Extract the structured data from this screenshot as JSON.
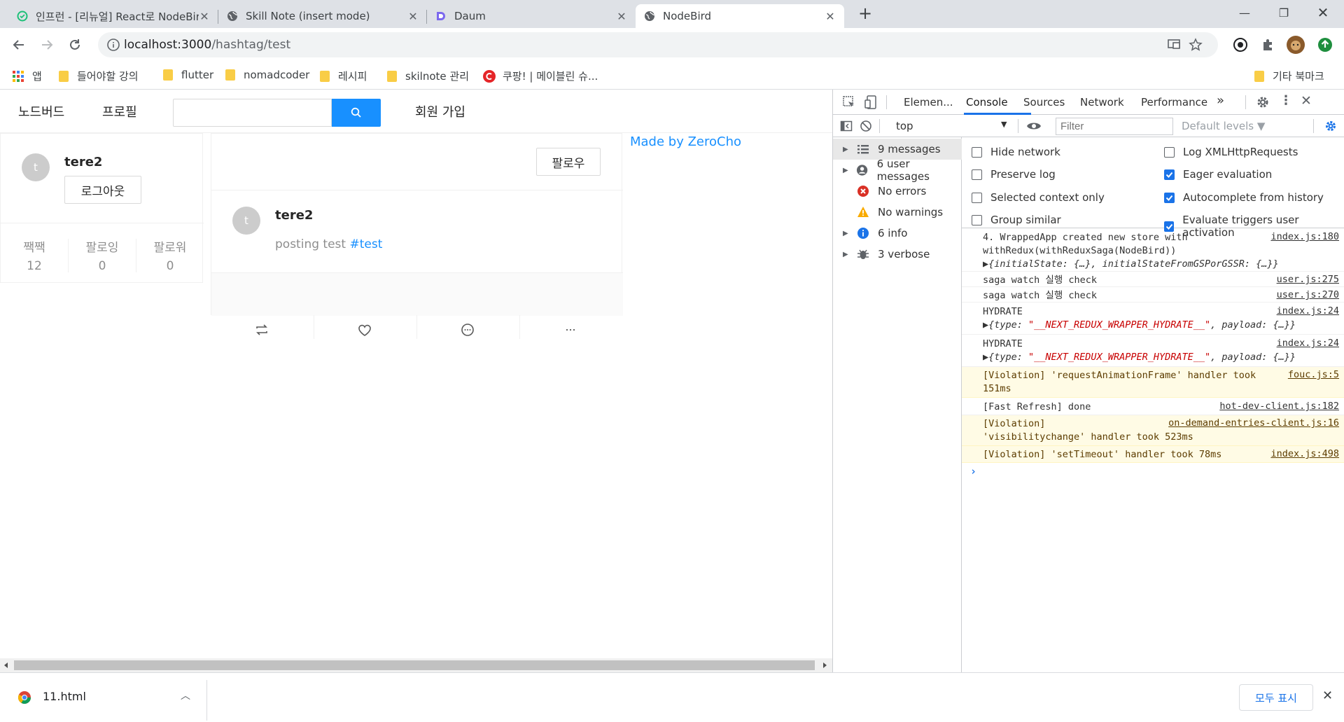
{
  "browser": {
    "tabs": [
      {
        "title": "인프런 - [리뉴얼] React로 NodeBird"
      },
      {
        "title": "Skill Note (insert mode)"
      },
      {
        "title": "Daum"
      },
      {
        "title": "NodeBird"
      }
    ],
    "url_host": "localhost:3000",
    "url_path": "/hashtag/test",
    "bookmarks": [
      "앱",
      "들어야할 강의",
      "flutter",
      "nomadcoder",
      "레시피",
      "skilnote 관리",
      "쿠팡! | 메이블린 슈...",
      "기타 북마크"
    ]
  },
  "app": {
    "nav": {
      "home": "노드버드",
      "profile": "프로필",
      "signup": "회원 가입",
      "search_placeholder": ""
    },
    "user_card": {
      "avatar_letter": "t",
      "name": "tere2",
      "logout": "로그아웃",
      "stats": [
        {
          "label": "짹짹",
          "value": "12"
        },
        {
          "label": "팔로잉",
          "value": "0"
        },
        {
          "label": "팔로워",
          "value": "0"
        }
      ]
    },
    "post": {
      "follow": "팔로우",
      "avatar_letter": "t",
      "author": "tere2",
      "text": "posting test ",
      "hashtag": "#test"
    },
    "credit": "Made by ZeroCho"
  },
  "devtools": {
    "tabs": [
      "Elemen...",
      "Console",
      "Sources",
      "Network",
      "Performance"
    ],
    "context": "top",
    "filter_placeholder": "Filter",
    "levels": "Default levels",
    "sidebar": [
      {
        "label": "9 messages",
        "icon": "list-icon"
      },
      {
        "label": "6 user messages",
        "icon": "user-icon"
      },
      {
        "label": "No errors",
        "icon": "error-icon"
      },
      {
        "label": "No warnings",
        "icon": "warning-icon"
      },
      {
        "label": "6 info",
        "icon": "info-icon"
      },
      {
        "label": "3 verbose",
        "icon": "bug-icon"
      }
    ],
    "settings": {
      "left": [
        {
          "label": "Hide network",
          "checked": false
        },
        {
          "label": "Preserve log",
          "checked": false
        },
        {
          "label": "Selected context only",
          "checked": false
        },
        {
          "label": "Group similar",
          "checked": false
        }
      ],
      "right": [
        {
          "label": "Log XMLHttpRequests",
          "checked": false
        },
        {
          "label": "Eager evaluation",
          "checked": true
        },
        {
          "label": "Autocomplete from history",
          "checked": true
        },
        {
          "label": "Evaluate triggers user activation",
          "checked": true
        }
      ]
    },
    "messages": [
      {
        "l1": "4. WrappedApp created new store with",
        "l2": "withRedux(withReduxSaga(NodeBird))",
        "l3": "▶{initialState: {…}, initialStateFromGSPorGSSR: {…}}",
        "src": "index.js:180"
      },
      {
        "l1": "saga watch 실행 check",
        "src": "user.js:275"
      },
      {
        "l1": "saga watch 실행 check",
        "src": "user.js:270"
      },
      {
        "l1": "HYDRATE",
        "l2a": "▶{type: ",
        "l2b": "\"__NEXT_REDUX_WRAPPER_HYDRATE__\"",
        "l2c": ", payload: {…}}",
        "src": "index.js:24"
      },
      {
        "l1": "HYDRATE",
        "l2a": "▶{type: ",
        "l2b": "\"__NEXT_REDUX_WRAPPER_HYDRATE__\"",
        "l2c": ", payload: {…}}",
        "src": "index.js:24"
      },
      {
        "l1": "[Violation] 'requestAnimationFrame' handler took",
        "l2": "151ms",
        "src": "fouc.js:5"
      },
      {
        "l1": "[Fast Refresh] done",
        "src": "hot-dev-client.js:182"
      },
      {
        "l1": "[Violation]",
        "l2": "'visibilitychange' handler took 523ms",
        "src": "on-demand-entries-client.js:16"
      },
      {
        "l1": "[Violation] 'setTimeout' handler took 78ms",
        "src": "index.js:498"
      }
    ]
  },
  "downloads": {
    "file": "11.html",
    "show_all": "모두 표시"
  }
}
